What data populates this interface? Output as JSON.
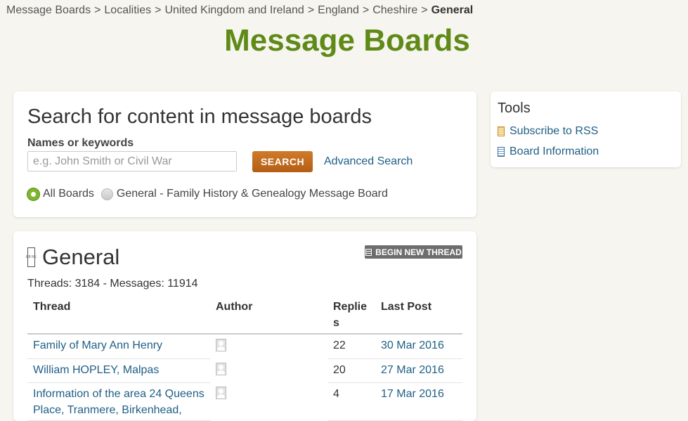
{
  "breadcrumb": {
    "items": [
      "Message Boards",
      "Localities",
      "United Kingdom and Ireland",
      "England",
      "Cheshire"
    ],
    "current": "General",
    "separator": ">"
  },
  "page_title": "Message Boards",
  "search": {
    "heading": "Search for content in message boards",
    "label": "Names or keywords",
    "placeholder": "e.g. John Smith or Civil War",
    "button_label": "SEARCH",
    "advanced_link": "Advanced Search",
    "scopes": [
      {
        "label": "All Boards",
        "selected": true
      },
      {
        "label": "General - Family History & Genealogy Message Board",
        "selected": false
      }
    ]
  },
  "tools": {
    "heading": "Tools",
    "links": [
      {
        "label": "Subscribe to RSS",
        "icon": "rss-icon"
      },
      {
        "label": "Board Information",
        "icon": "info-icon"
      }
    ]
  },
  "board": {
    "icon_text": "EB NE",
    "name": "General",
    "new_thread_label": "BEGIN NEW THREAD",
    "stats": "Threads: 3184 - Messages: 11914",
    "columns": {
      "thread": "Thread",
      "author": "Author",
      "replies": "Replies",
      "last_post": "Last Post"
    },
    "threads": [
      {
        "title": "Family of Mary Ann Henry",
        "replies": "22",
        "last_post": "30 Mar 2016"
      },
      {
        "title": "William HOPLEY, Malpas",
        "replies": "20",
        "last_post": "27 Mar 2016"
      },
      {
        "title": "Information of the area 24 Queens Place, Tranmere, Birkenhead,",
        "replies": "4",
        "last_post": "17 Mar 2016"
      }
    ]
  },
  "colors": {
    "accent_green": "#5f8a17",
    "link_blue": "#1f5f86",
    "search_button": "#c26b1d",
    "background": "#f6f5ef"
  }
}
